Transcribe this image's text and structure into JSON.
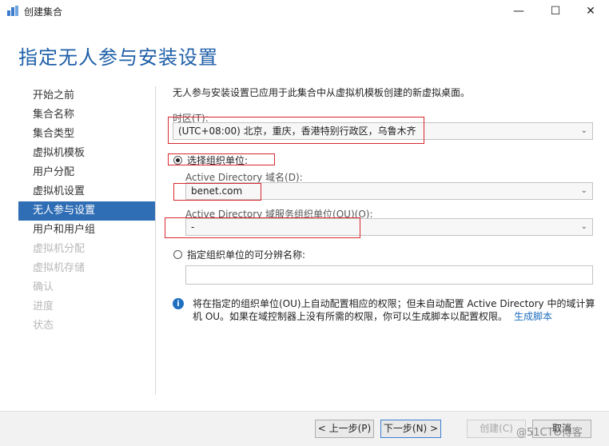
{
  "window": {
    "title": "创建集合",
    "minimize_glyph": "—",
    "maximize_glyph": "☐",
    "close_glyph": "✕"
  },
  "page": {
    "title": "指定无人参与安装设置",
    "description": "无人参与安装设置已应用于此集合中从虚拟机模板创建的新虚拟桌面。"
  },
  "nav": {
    "items": [
      {
        "label": "开始之前",
        "state": "normal"
      },
      {
        "label": "集合名称",
        "state": "normal"
      },
      {
        "label": "集合类型",
        "state": "normal"
      },
      {
        "label": "虚拟机模板",
        "state": "normal"
      },
      {
        "label": "用户分配",
        "state": "normal"
      },
      {
        "label": "虚拟机设置",
        "state": "normal"
      },
      {
        "label": "无人参与设置",
        "state": "active"
      },
      {
        "label": "用户和用户组",
        "state": "normal"
      },
      {
        "label": "虚拟机分配",
        "state": "disabled"
      },
      {
        "label": "虚拟机存储",
        "state": "disabled"
      },
      {
        "label": "确认",
        "state": "disabled"
      },
      {
        "label": "进度",
        "state": "disabled"
      },
      {
        "label": "状态",
        "state": "disabled"
      }
    ]
  },
  "form": {
    "timezone": {
      "label": "时区(T):",
      "value": "(UTC+08:00) 北京，重庆，香港特别行政区，乌鲁木齐"
    },
    "radio_select_ou": {
      "label": "选择组织单位:",
      "checked": true
    },
    "ad_domain": {
      "label": "Active Directory 域名(D):",
      "value": "benet.com"
    },
    "ad_ou": {
      "label": "Active Directory 域服务组织单位(OU)(O):",
      "value": "-"
    },
    "radio_dn": {
      "label": "指定组织单位的可分辨名称:",
      "checked": false
    },
    "dn_value": ""
  },
  "info": {
    "text": "将在指定的组织单位(OU)上自动配置相应的权限；但未自动配置 Active Directory 中的域计算机 OU。如果在域控制器上没有所需的权限，你可以生成脚本以配置权限。",
    "link": "生成脚本"
  },
  "footer": {
    "prev": "< 上一步(P)",
    "next": "下一步(N) >",
    "create": "创建(C)",
    "cancel": "取消"
  },
  "watermark": "@51CTO博客",
  "colors": {
    "accent": "#2f6db5",
    "title": "#1f5fa8",
    "highlight": "#d9282f"
  }
}
